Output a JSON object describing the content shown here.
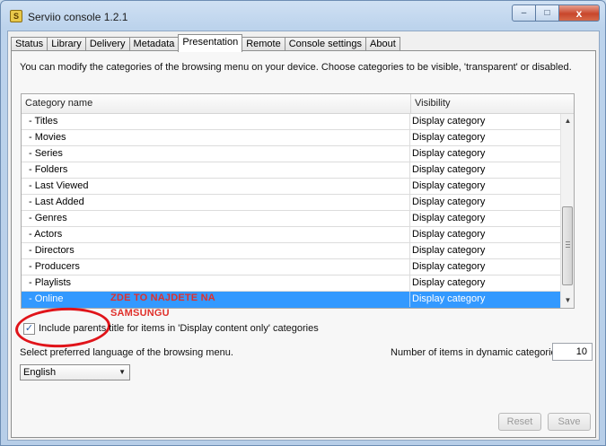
{
  "window": {
    "title": "Serviio console 1.2.1",
    "app_icon": "serviio-icon",
    "controls": {
      "minimize": "–",
      "maximize": "□",
      "close": "x"
    }
  },
  "tabs": [
    {
      "label": "Status",
      "active": false
    },
    {
      "label": "Library",
      "active": false
    },
    {
      "label": "Delivery",
      "active": false
    },
    {
      "label": "Metadata",
      "active": false
    },
    {
      "label": "Presentation",
      "active": true
    },
    {
      "label": "Remote",
      "active": false
    },
    {
      "label": "Console settings",
      "active": false
    },
    {
      "label": "About",
      "active": false
    }
  ],
  "presentation": {
    "description": "You can modify the categories of the browsing menu on your device. Choose categories to be visible, 'transparent' or disabled.",
    "table": {
      "columns": [
        "Category name",
        "Visibility"
      ],
      "rows": [
        {
          "name": "- Titles",
          "visibility": "Display category",
          "selected": false
        },
        {
          "name": "- Movies",
          "visibility": "Display category",
          "selected": false
        },
        {
          "name": "- Series",
          "visibility": "Display category",
          "selected": false
        },
        {
          "name": "- Folders",
          "visibility": "Display category",
          "selected": false
        },
        {
          "name": "- Last Viewed",
          "visibility": "Display category",
          "selected": false
        },
        {
          "name": "- Last Added",
          "visibility": "Display category",
          "selected": false
        },
        {
          "name": "- Genres",
          "visibility": "Display category",
          "selected": false
        },
        {
          "name": "- Actors",
          "visibility": "Display category",
          "selected": false
        },
        {
          "name": "- Directors",
          "visibility": "Display category",
          "selected": false
        },
        {
          "name": "- Producers",
          "visibility": "Display category",
          "selected": false
        },
        {
          "name": "- Playlists",
          "visibility": "Display category",
          "selected": false
        },
        {
          "name": "- Online",
          "visibility": "Display category",
          "selected": true
        }
      ],
      "scrollbar": {
        "up_arrow": "▲",
        "down_arrow": "▼"
      }
    },
    "annotation": {
      "line1": "ZDE TO NAJDETE NA",
      "line2": "SAMSUNGU",
      "color": "#e0302b"
    },
    "include_parents": {
      "checked": true,
      "check_mark": "✓",
      "label": "Include parents title for items in 'Display content only' categories"
    },
    "language": {
      "label": "Select preferred language of the browsing menu.",
      "value": "English",
      "caret": "▼"
    },
    "dynamic_items": {
      "label": "Number of items in dynamic categories:",
      "value": "10"
    },
    "buttons": {
      "reset": "Reset",
      "save": "Save"
    }
  },
  "colors": {
    "selection": "#3399ff",
    "annotation": "#e0302b",
    "titlebar": "#bcd3ec"
  }
}
